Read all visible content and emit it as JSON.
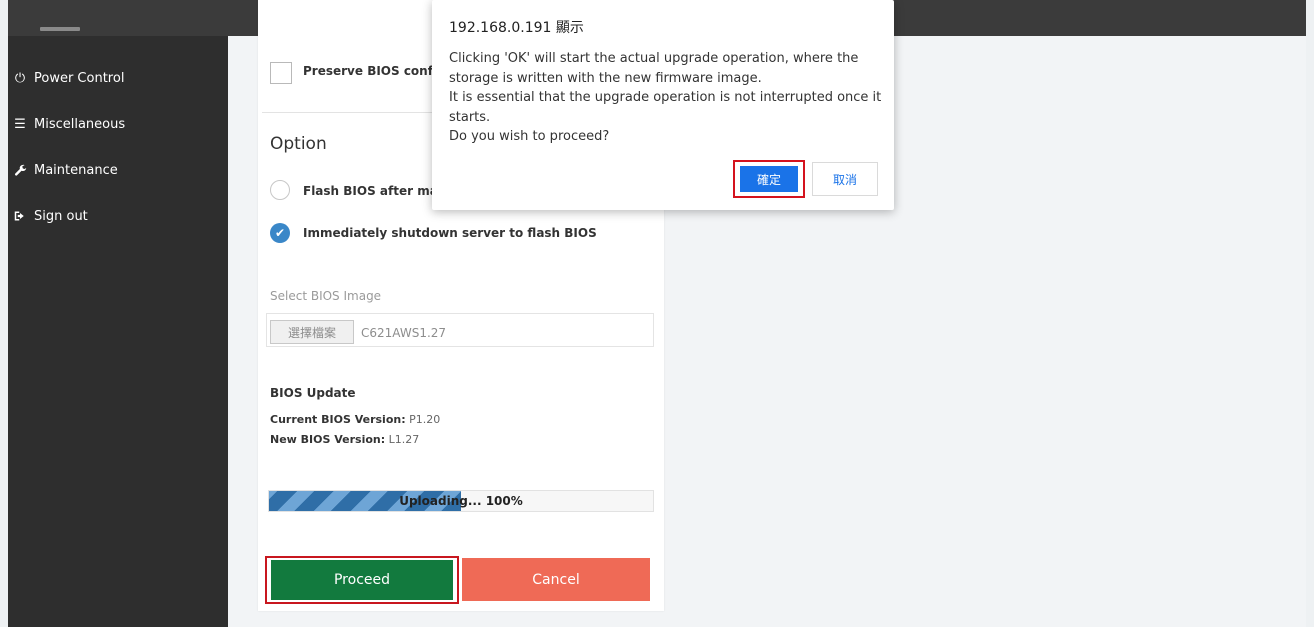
{
  "sidebar": {
    "items": [
      {
        "label": "Power Control",
        "icon": "power-icon"
      },
      {
        "label": "Miscellaneous",
        "icon": "menu-icon"
      },
      {
        "label": "Maintenance",
        "icon": "wrench-icon"
      },
      {
        "label": "Sign out",
        "icon": "sign-out-icon"
      }
    ]
  },
  "bios": {
    "preserve_label": "Preserve BIOS config",
    "option_title": "Option",
    "radio_flash_after": "Flash BIOS after mar",
    "radio_immediate": "Immediately shutdown server to flash BIOS",
    "select_label": "Select BIOS Image",
    "file_button": "選擇檔案",
    "file_name": "C621AWS1.27",
    "update_title": "BIOS Update",
    "current_label": "Current BIOS Version:",
    "current_value": "P1.20",
    "new_label": "New BIOS Version:",
    "new_value": "L1.27",
    "progress_text": "Uploading... 100%",
    "progress_fraction": 0.5,
    "proceed": "Proceed",
    "cancel": "Cancel"
  },
  "dialog": {
    "title": "192.168.0.191 顯示",
    "lines": [
      "Clicking 'OK' will start the actual upgrade operation, where the",
      "storage is written with the new firmware image.",
      "It is essential that the upgrade operation is not interrupted once it",
      "starts.",
      "Do you wish to proceed?"
    ],
    "ok": "確定",
    "cancel": "取消"
  },
  "colors": {
    "sidebar": "#2e2e2e",
    "proceed": "#127a3e",
    "cancel": "#ef6a56",
    "highlight": "#d4131e",
    "ok": "#1a73e8"
  }
}
